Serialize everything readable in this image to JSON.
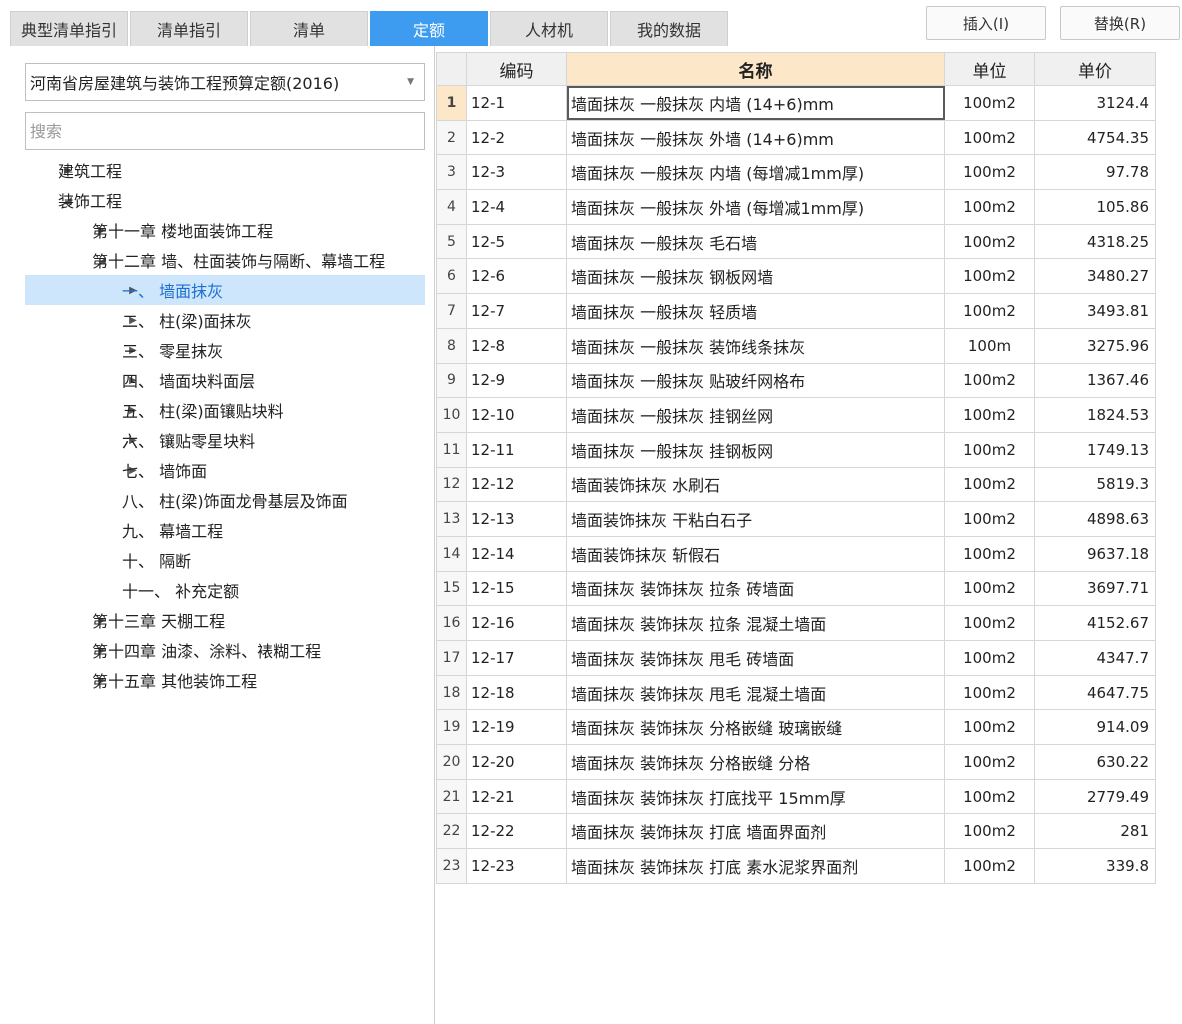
{
  "tabs": [
    {
      "label": "典型清单指引",
      "active": false
    },
    {
      "label": "清单指引",
      "active": false
    },
    {
      "label": "清单",
      "active": false
    },
    {
      "label": "定额",
      "active": true
    },
    {
      "label": "人材机",
      "active": false
    },
    {
      "label": "我的数据",
      "active": false
    }
  ],
  "toolbar": {
    "insert_label": "插入(I)",
    "replace_label": "替换(R)"
  },
  "quota_library": {
    "selected": "河南省房屋建筑与装饰工程预算定额(2016)"
  },
  "search": {
    "placeholder": "搜索",
    "value": ""
  },
  "tree": [
    {
      "label": "建筑工程",
      "arrow": "▶",
      "level": 0,
      "selected": false
    },
    {
      "label": "装饰工程",
      "arrow": "◢",
      "level": 0,
      "selected": false
    },
    {
      "label": "第十一章 楼地面装饰工程",
      "arrow": "▶",
      "level": 1,
      "selected": false
    },
    {
      "label": "第十二章 墙、柱面装饰与隔断、幕墙工程",
      "arrow": "◢",
      "level": 1,
      "selected": false
    },
    {
      "label": "一、 墙面抹灰",
      "arrow": "▶",
      "level": 2,
      "selected": true
    },
    {
      "label": "二、 柱(梁)面抹灰",
      "arrow": "▶",
      "level": 2,
      "selected": false
    },
    {
      "label": "三、 零星抹灰",
      "arrow": "▶",
      "level": 2,
      "selected": false
    },
    {
      "label": "四、 墙面块料面层",
      "arrow": "▶",
      "level": 2,
      "selected": false
    },
    {
      "label": "五、 柱(梁)面镶贴块料",
      "arrow": "▶",
      "level": 2,
      "selected": false
    },
    {
      "label": "六、 镶贴零星块料",
      "arrow": "▶",
      "level": 2,
      "selected": false
    },
    {
      "label": "七、 墙饰面",
      "arrow": "▶",
      "level": 2,
      "selected": false
    },
    {
      "label": "八、 柱(梁)饰面龙骨基层及饰面",
      "arrow": "",
      "level": 2,
      "selected": false
    },
    {
      "label": "九、 幕墙工程",
      "arrow": "",
      "level": 2,
      "selected": false
    },
    {
      "label": "十、 隔断",
      "arrow": "",
      "level": 2,
      "selected": false
    },
    {
      "label": "十一、 补充定额",
      "arrow": "",
      "level": 2,
      "selected": false
    },
    {
      "label": "第十三章 天棚工程",
      "arrow": "▶",
      "level": 1,
      "selected": false
    },
    {
      "label": "第十四章 油漆、涂料、裱糊工程",
      "arrow": "▶",
      "level": 1,
      "selected": false
    },
    {
      "label": "第十五章 其他装饰工程",
      "arrow": "▶",
      "level": 1,
      "selected": false
    }
  ],
  "table": {
    "headers": {
      "code": "编码",
      "name": "名称",
      "unit": "单位",
      "price": "单价"
    },
    "current_row": 1,
    "rows": [
      {
        "no": "1",
        "code": "12-1",
        "name": "墙面抹灰 一般抹灰 内墙 (14+6)mm",
        "unit": "100m2",
        "price": "3124.4"
      },
      {
        "no": "2",
        "code": "12-2",
        "name": "墙面抹灰 一般抹灰 外墙 (14+6)mm",
        "unit": "100m2",
        "price": "4754.35"
      },
      {
        "no": "3",
        "code": "12-3",
        "name": "墙面抹灰 一般抹灰 内墙 (每增减1mm厚)",
        "unit": "100m2",
        "price": "97.78"
      },
      {
        "no": "4",
        "code": "12-4",
        "name": "墙面抹灰 一般抹灰 外墙 (每增减1mm厚)",
        "unit": "100m2",
        "price": "105.86"
      },
      {
        "no": "5",
        "code": "12-5",
        "name": "墙面抹灰 一般抹灰 毛石墙",
        "unit": "100m2",
        "price": "4318.25"
      },
      {
        "no": "6",
        "code": "12-6",
        "name": "墙面抹灰 一般抹灰 钢板网墙",
        "unit": "100m2",
        "price": "3480.27"
      },
      {
        "no": "7",
        "code": "12-7",
        "name": "墙面抹灰 一般抹灰 轻质墙",
        "unit": "100m2",
        "price": "3493.81"
      },
      {
        "no": "8",
        "code": "12-8",
        "name": "墙面抹灰 一般抹灰 装饰线条抹灰",
        "unit": "100m",
        "price": "3275.96"
      },
      {
        "no": "9",
        "code": "12-9",
        "name": "墙面抹灰 一般抹灰 贴玻纤网格布",
        "unit": "100m2",
        "price": "1367.46"
      },
      {
        "no": "10",
        "code": "12-10",
        "name": "墙面抹灰 一般抹灰 挂钢丝网",
        "unit": "100m2",
        "price": "1824.53"
      },
      {
        "no": "11",
        "code": "12-11",
        "name": "墙面抹灰 一般抹灰 挂钢板网",
        "unit": "100m2",
        "price": "1749.13"
      },
      {
        "no": "12",
        "code": "12-12",
        "name": "墙面装饰抹灰 水刷石",
        "unit": "100m2",
        "price": "5819.3"
      },
      {
        "no": "13",
        "code": "12-13",
        "name": "墙面装饰抹灰 干粘白石子",
        "unit": "100m2",
        "price": "4898.63"
      },
      {
        "no": "14",
        "code": "12-14",
        "name": "墙面装饰抹灰 斩假石",
        "unit": "100m2",
        "price": "9637.18"
      },
      {
        "no": "15",
        "code": "12-15",
        "name": "墙面抹灰 装饰抹灰 拉条 砖墙面",
        "unit": "100m2",
        "price": "3697.71"
      },
      {
        "no": "16",
        "code": "12-16",
        "name": "墙面抹灰 装饰抹灰 拉条 混凝土墙面",
        "unit": "100m2",
        "price": "4152.67"
      },
      {
        "no": "17",
        "code": "12-17",
        "name": "墙面抹灰 装饰抹灰 甩毛 砖墙面",
        "unit": "100m2",
        "price": "4347.7"
      },
      {
        "no": "18",
        "code": "12-18",
        "name": "墙面抹灰 装饰抹灰 甩毛 混凝土墙面",
        "unit": "100m2",
        "price": "4647.75"
      },
      {
        "no": "19",
        "code": "12-19",
        "name": "墙面抹灰 装饰抹灰 分格嵌缝 玻璃嵌缝",
        "unit": "100m2",
        "price": "914.09"
      },
      {
        "no": "20",
        "code": "12-20",
        "name": "墙面抹灰 装饰抹灰 分格嵌缝 分格",
        "unit": "100m2",
        "price": "630.22"
      },
      {
        "no": "21",
        "code": "12-21",
        "name": "墙面抹灰 装饰抹灰 打底找平 15mm厚",
        "unit": "100m2",
        "price": "2779.49"
      },
      {
        "no": "22",
        "code": "12-22",
        "name": "墙面抹灰 装饰抹灰 打底 墙面界面剂",
        "unit": "100m2",
        "price": "281"
      },
      {
        "no": "23",
        "code": "12-23",
        "name": "墙面抹灰 装饰抹灰 打底 素水泥浆界面剂",
        "unit": "100m2",
        "price": "339.8"
      }
    ]
  },
  "colors": {
    "accent": "#3d9cf0",
    "selection": "#cde6fb",
    "header_highlight": "#fde7c9"
  }
}
